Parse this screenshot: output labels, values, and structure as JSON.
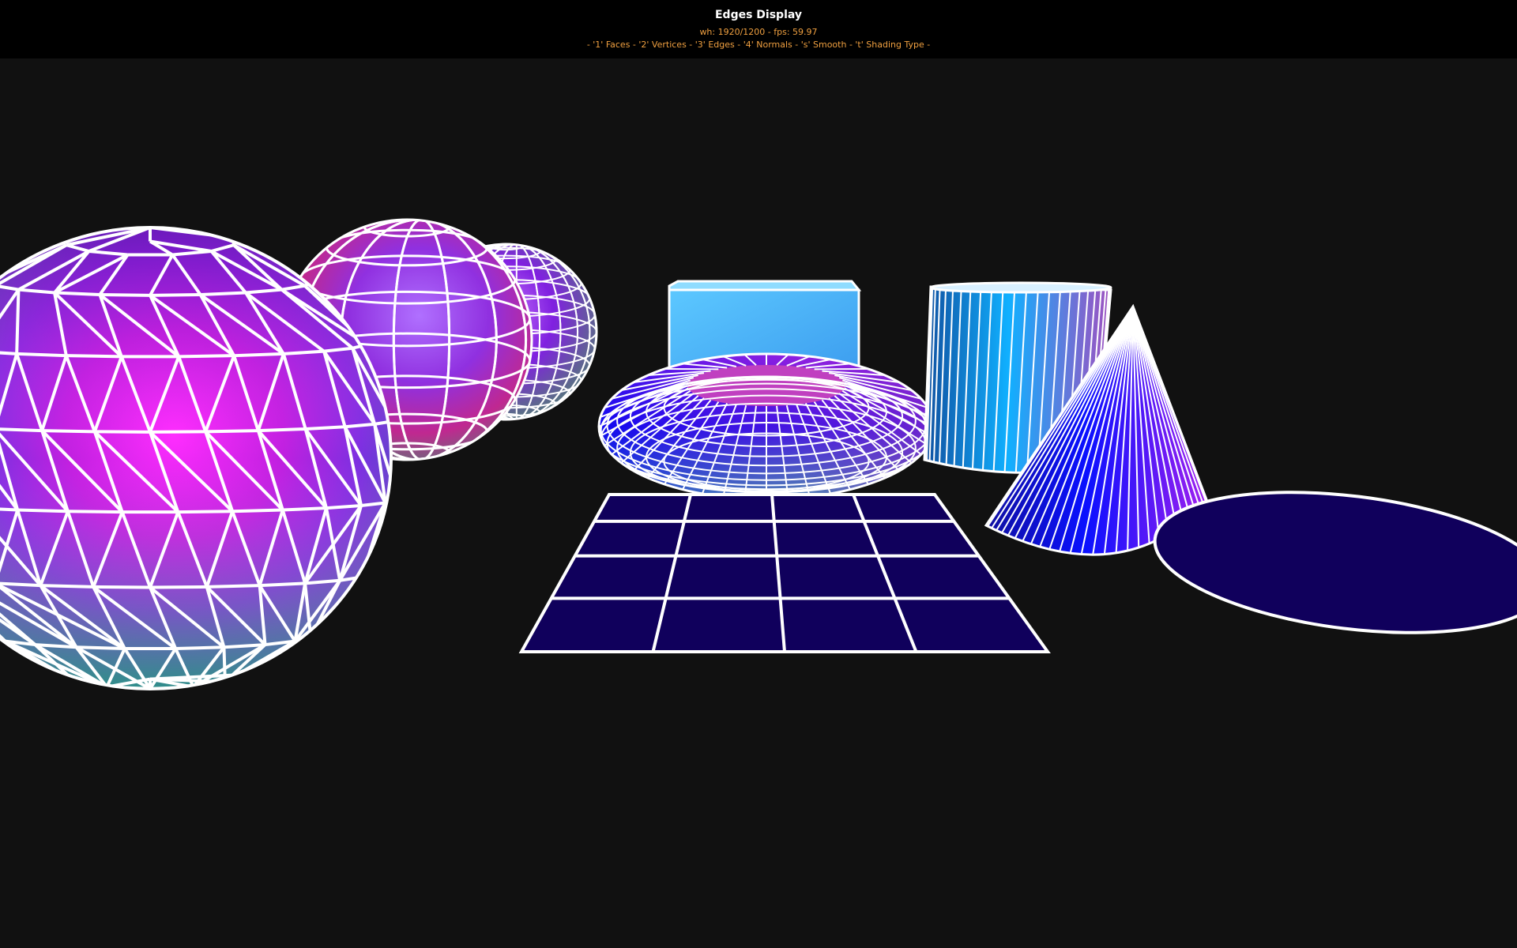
{
  "window": {
    "title": "Edges Display",
    "stats": "wh: 1920/1200 - fps: 59.97",
    "keys": "- '1' Faces - '2' Vertices - '3' Edges - '4' Normals - 's' Smooth - 't' Shading Type -"
  },
  "colors": {
    "background": "#111111",
    "header": "#000000",
    "title_text": "#ffffff",
    "info_text": "#f0a040",
    "edge": "#ffffff",
    "plane_fill": "#10005c"
  },
  "scene": {
    "objects": [
      {
        "name": "geodesic-sphere-large",
        "type": "sphere"
      },
      {
        "name": "sphere-medium",
        "type": "sphere"
      },
      {
        "name": "sphere-small",
        "type": "sphere"
      },
      {
        "name": "box",
        "type": "cube"
      },
      {
        "name": "torus",
        "type": "torus"
      },
      {
        "name": "grid-plane",
        "type": "plane"
      },
      {
        "name": "cylinder",
        "type": "cylinder"
      },
      {
        "name": "cone",
        "type": "cone"
      },
      {
        "name": "disc",
        "type": "disc"
      }
    ]
  }
}
